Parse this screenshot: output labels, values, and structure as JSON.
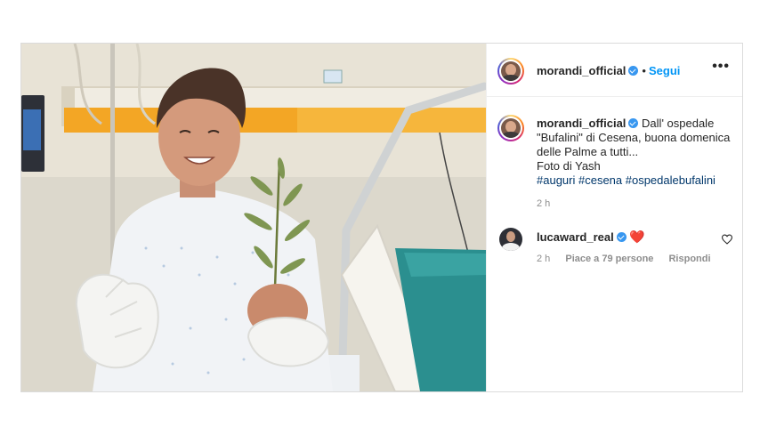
{
  "post": {
    "username": "morandi_official",
    "follow_label": "Segui",
    "separator": "•",
    "more_label": "•••",
    "caption": {
      "line1": "Dall' ospedale",
      "line2": "\"Bufalini\" di Cesena, buona domenica",
      "line3": "delle Palme a tutti...",
      "line4": "Foto di Yash",
      "hashtags": "#auguri #cesena #ospedalebufalini"
    },
    "time": "2 h"
  },
  "comment": {
    "username": "lucaward_real",
    "emoji": "❤️",
    "time": "2 h",
    "likes": "Piace a 79 persone",
    "reply_label": "Rispondi"
  },
  "colors": {
    "link_blue": "#0095f6",
    "hashtag": "#00376b",
    "verified": "#3897f0",
    "muted": "#8e8e8e"
  },
  "icons": [
    "verified-badge-icon",
    "more-options-icon",
    "like-heart-icon",
    "heart-emoji"
  ]
}
